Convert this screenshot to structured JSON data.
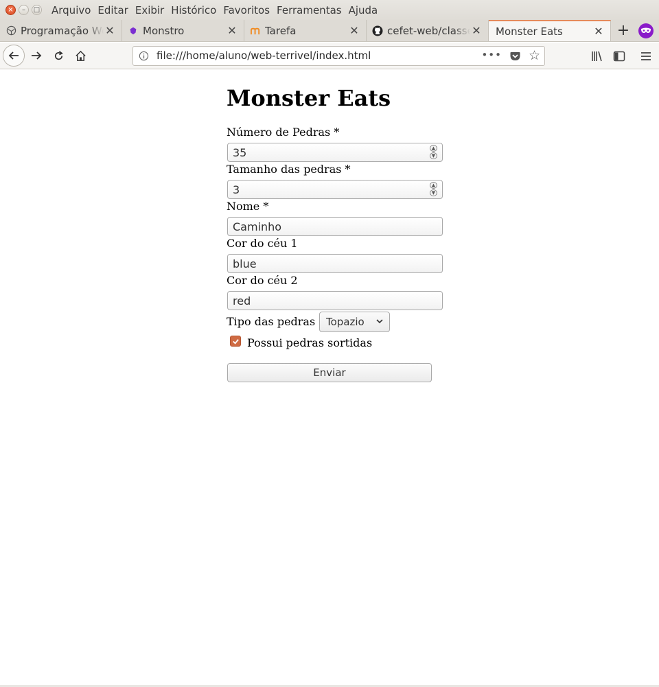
{
  "menubar": {
    "items": [
      "Arquivo",
      "Editar",
      "Exibir",
      "Histórico",
      "Favoritos",
      "Ferramentas",
      "Ajuda"
    ]
  },
  "tabs": [
    {
      "title": "Programação Web",
      "icon": "web-globe-icon",
      "active": false
    },
    {
      "title": "Monstro",
      "icon": "gem-icon",
      "active": false
    },
    {
      "title": "Tarefa",
      "icon": "moodle-icon",
      "active": false
    },
    {
      "title": "cefet-web/classes",
      "icon": "github-icon",
      "active": false
    },
    {
      "title": "Monster Eats",
      "icon": "",
      "active": true
    }
  ],
  "navbar": {
    "url": "file:///home/aluno/web-terrivel/index.html"
  },
  "page": {
    "title": "Monster Eats",
    "form": {
      "num_pedras_label": "Número de Pedras *",
      "num_pedras_value": "35",
      "tamanho_label": "Tamanho das pedras *",
      "tamanho_value": "3",
      "nome_label": "Nome *",
      "nome_value": "Caminho",
      "cor1_label": "Cor do céu 1",
      "cor1_value": "blue",
      "cor2_label": "Cor do céu 2",
      "cor2_value": "red",
      "tipo_label": "Tipo das pedras",
      "tipo_value": "Topazio",
      "sortidas_label": "Possui pedras sortidas",
      "sortidas_checked": true,
      "submit_label": "Enviar"
    }
  },
  "colors": {
    "accent": "#cf6b43",
    "tab_active_border": "#e58a5a",
    "privacy_badge": "#8a1bc9"
  }
}
